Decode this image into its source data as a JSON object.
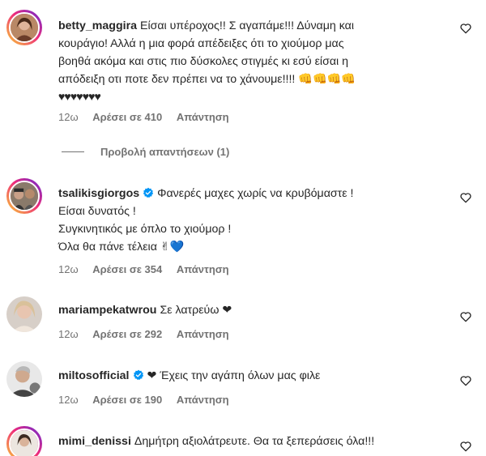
{
  "comments": [
    {
      "username": "betty_maggira",
      "lines": [
        "Είσαι υπέροχος!! Σ αγαπάμε!!! Δύναμη και",
        "κουράγιο! Αλλά η μια φορά απέδειξες ότι το χιούμορ μας",
        "βοηθά ακόμα και στις πιο δύσκολες στιγμές κι εσύ είσαι η",
        "απόδειξη οτι ποτε δεν πρέπει να το χάνουμε!!!! 👊👊👊👊",
        "♥♥♥♥♥♥♥"
      ],
      "time": "12ω",
      "likes": "Αρέσει σε 410",
      "reply": "Απάντηση"
    },
    {
      "username": "tsalikisgiorgos",
      "verified": true,
      "lines": [
        "Φανερές μαχες χωρίς να κρυβόμαστε !",
        "Είσαι δυνατός !",
        "Συγκινητικός με όπλο το χιούμορ !",
        "Όλα θα πάνε τέλεια ✌💙"
      ],
      "time": "12ω",
      "likes": "Αρέσει σε 354",
      "reply": "Απάντηση"
    },
    {
      "username": "mariampekatwrou",
      "lines": [
        "Σε λατρεύω ❤"
      ],
      "time": "12ω",
      "likes": "Αρέσει σε 292",
      "reply": "Απάντηση"
    },
    {
      "username": "miltosofficial",
      "verified": true,
      "lines": [
        "❤ Έχεις την αγάπη όλων μας φιλε"
      ],
      "time": "12ω",
      "likes": "Αρέσει σε 190",
      "reply": "Απάντηση"
    },
    {
      "username": "mimi_denissi",
      "lines": [
        "Δημήτρη αξιολάτρευτε. Θα τα ξεπεράσεις όλα!!!"
      ],
      "time": "",
      "likes": "",
      "reply": ""
    }
  ],
  "view_replies": "Προβολή απαντήσεων (1)",
  "colors": {
    "text": "#262626",
    "meta": "#737373",
    "verified": "#0095f6",
    "heart": "#ed1c24",
    "ring_start": "#f9ce34",
    "ring_mid": "#ee2a7b",
    "ring_end": "#6228d7"
  },
  "icons": {
    "like": "heart-outline-icon",
    "verified": "verified-badge-icon"
  }
}
